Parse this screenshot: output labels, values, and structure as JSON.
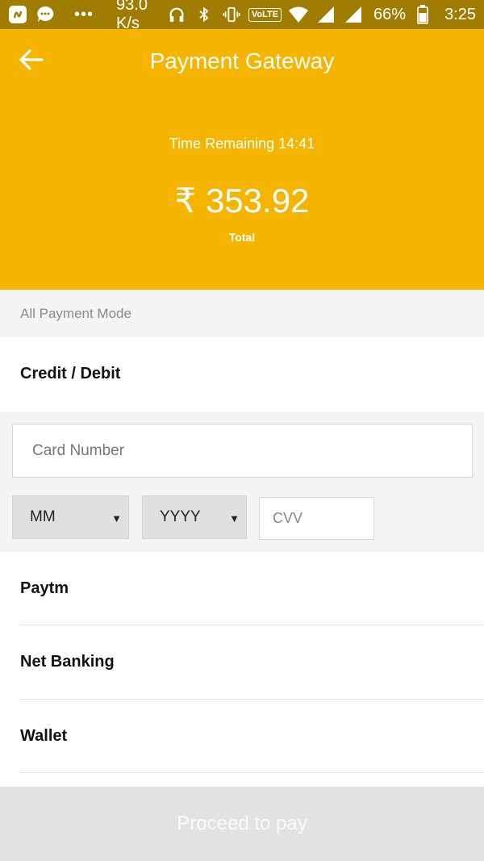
{
  "status_bar": {
    "network_speed": "93.0 K/s",
    "volte_label": "VoLTE",
    "battery_percent": "66%",
    "time": "3:25",
    "icons": [
      "app-s-icon",
      "message-icon",
      "more-icon",
      "headphones-icon",
      "bluetooth-icon",
      "vibrate-icon",
      "wifi-icon",
      "signal-icon",
      "battery-icon"
    ]
  },
  "header": {
    "title": "Payment Gateway",
    "time_remaining": "Time Remaining 14:41",
    "amount": "₹ 353.92",
    "amount_caption": "Total",
    "back_icon": "back-arrow-icon",
    "background_color": "#f4b400"
  },
  "payment_modes": {
    "section_label": "All Payment Mode",
    "credit_debit_label": "Credit / Debit",
    "card_form": {
      "card_number_placeholder": "Card Number",
      "month_value": "MM",
      "year_value": "YYYY",
      "cvv_placeholder": "CVV"
    },
    "items": [
      {
        "label": "Paytm"
      },
      {
        "label": "Net Banking"
      },
      {
        "label": "Wallet"
      }
    ]
  },
  "footer": {
    "proceed_label": "Proceed to pay"
  }
}
